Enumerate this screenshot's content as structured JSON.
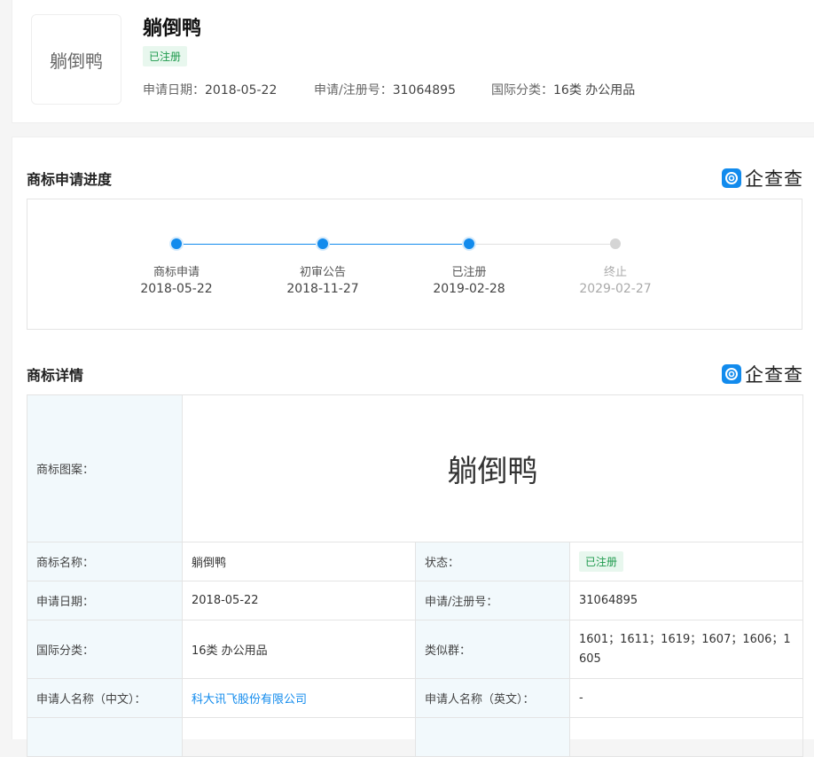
{
  "header": {
    "logo_text": "躺倒鸭",
    "title": "躺倒鸭",
    "status": "已注册",
    "meta": [
      {
        "label": "申请日期：",
        "value": "2018-05-22"
      },
      {
        "label": "申请/注册号：",
        "value": "31064895"
      },
      {
        "label": "国际分类：",
        "value": "16类 办公用品"
      }
    ]
  },
  "brand": {
    "name": "企查查",
    "color": "#128bed"
  },
  "progress": {
    "title": "商标申请进度",
    "steps": [
      {
        "label": "商标申请",
        "date": "2018-05-22",
        "done": true
      },
      {
        "label": "初审公告",
        "date": "2018-11-27",
        "done": true
      },
      {
        "label": "已注册",
        "date": "2019-02-28",
        "done": true
      },
      {
        "label": "终止",
        "date": "2029-02-27",
        "done": false
      }
    ]
  },
  "detail": {
    "title": "商标详情",
    "mark_label": "商标图案：",
    "mark_text": "躺倒鸭",
    "rows": [
      {
        "k1": "商标名称：",
        "v1": "躺倒鸭",
        "k2": "状态：",
        "v2": "已注册"
      },
      {
        "k1": "申请日期：",
        "v1": "2018-05-22",
        "k2": "申请/注册号：",
        "v2": "31064895"
      },
      {
        "k1": "国际分类：",
        "v1": "16类 办公用品",
        "k2": "类似群：",
        "v2": "1601；1611；1619；1607；1606；1605"
      },
      {
        "k1": "申请人名称（中文）：",
        "v1": "科大讯飞股份有限公司",
        "k2": "申请人名称（英文）：",
        "v2": "-"
      }
    ]
  }
}
